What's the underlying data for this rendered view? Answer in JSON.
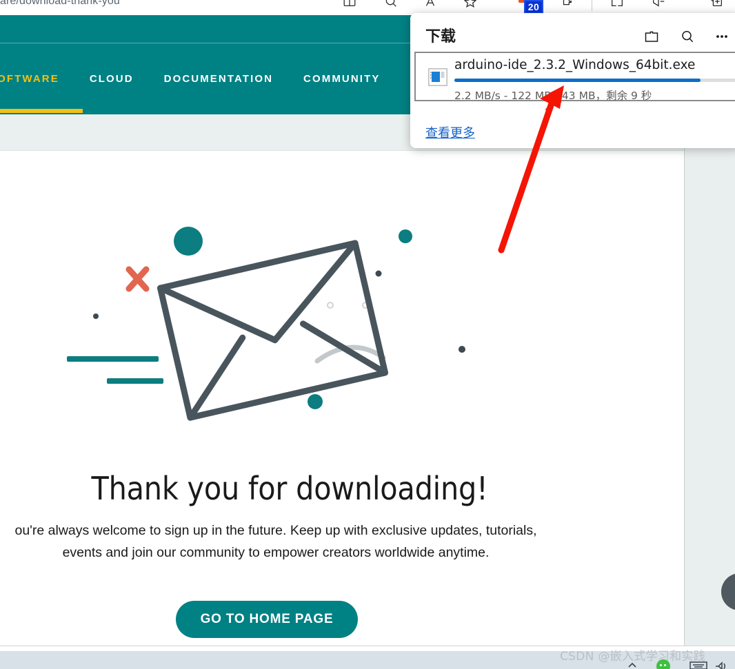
{
  "browser": {
    "url_fragment": "are/download-thank-you",
    "extension_badge_count": "20",
    "toolbar_icons": [
      "split-screen-icon",
      "search-icon",
      "read-aloud-icon",
      "favorite-star-icon",
      "extension-badge-icon",
      "puzzle-extensions-icon",
      "split-window-icon",
      "collections-icon",
      "add-tab-icon"
    ]
  },
  "downloads": {
    "title": "下载",
    "header_icons": [
      "folder-icon",
      "search-icon",
      "more-options-icon"
    ],
    "item": {
      "filename": "arduino-ide_2.3.2_Windows_64bit.exe",
      "status": "2.2 MB/s - 122 MB/143 MB，剩余 9 秒",
      "speed": "2.2 MB/s",
      "downloaded": "122 MB",
      "total": "143 MB",
      "time_remaining": "剩余 9 秒",
      "progress_percent": 85,
      "progress_color": "#0c6ec9"
    },
    "see_more_label": "查看更多",
    "see_more_color": "#1562c6"
  },
  "site": {
    "nav": {
      "items": [
        {
          "label": "SOFTWARE",
          "active": true
        },
        {
          "label": "CLOUD",
          "active": false
        },
        {
          "label": "DOCUMENTATION",
          "active": false
        },
        {
          "label": "COMMUNITY",
          "active": false
        }
      ],
      "bar_color": "#008184",
      "active_color": "#f1c016"
    },
    "headline": "Thank you for downloading!",
    "body_line1": "ou're always welcome to sign up in the future. Keep up with exclusive updates, tutorials,",
    "body_line2": "events and join our community to empower creators worldwide anytime.",
    "cta_label": "GO TO HOME PAGE",
    "cta_color": "#008184"
  },
  "annotation": {
    "arrow_color": "#f41505",
    "arrow_from": "728,362",
    "arrow_to": "814,128"
  },
  "watermark": {
    "text": "CSDN @嵌入式学习和实践"
  },
  "taskbar": {
    "tray_icons": [
      "chevron-up-icon",
      "wechat-icon",
      "keyboard-icon",
      "volume-icon"
    ]
  }
}
